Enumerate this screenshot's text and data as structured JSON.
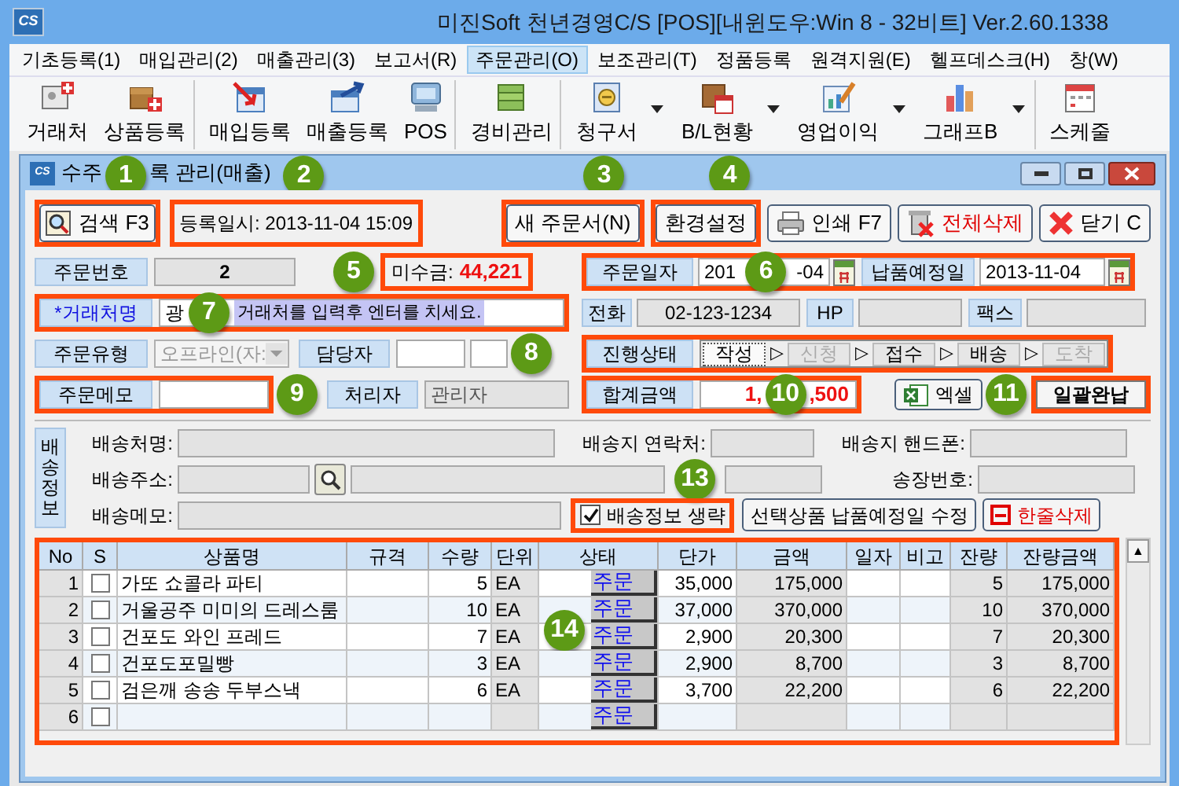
{
  "window": {
    "title": "미진Soft 천년경영C/S [POS][내윈도우:Win 8 - 32비트] Ver.2.60.1338",
    "logo": "CS"
  },
  "menu": [
    {
      "label": "기초등록(1)",
      "selected": false
    },
    {
      "label": "매입관리(2)",
      "selected": false
    },
    {
      "label": "매출관리(3)",
      "selected": false
    },
    {
      "label": "보고서(R)",
      "selected": false
    },
    {
      "label": "주문관리(O)",
      "selected": true
    },
    {
      "label": "보조관리(T)",
      "selected": false
    },
    {
      "label": "정품등록",
      "selected": false
    },
    {
      "label": "원격지원(E)",
      "selected": false
    },
    {
      "label": "헬프데스크(H)",
      "selected": false
    },
    {
      "label": "창(W)",
      "selected": false
    }
  ],
  "toolbar": [
    {
      "label": "거래처",
      "kind": "card",
      "dropdown": false,
      "separator_after": false
    },
    {
      "label": "상품등록",
      "kind": "box",
      "dropdown": false,
      "separator_after": true
    },
    {
      "label": "매입등록",
      "kind": "sheet-in",
      "dropdown": false,
      "separator_after": false
    },
    {
      "label": "매출등록",
      "kind": "sheet-out",
      "dropdown": false,
      "separator_after": false
    },
    {
      "label": "POS",
      "kind": "monitor",
      "dropdown": false,
      "separator_after": true
    },
    {
      "label": "경비관리",
      "kind": "money",
      "dropdown": false,
      "separator_after": true
    },
    {
      "label": "청구서",
      "kind": "invoice",
      "dropdown": true,
      "separator_after": false
    },
    {
      "label": "B/L현황",
      "kind": "crate",
      "dropdown": true,
      "separator_after": false
    },
    {
      "label": "영업이익",
      "kind": "pen",
      "dropdown": true,
      "separator_after": false
    },
    {
      "label": "그래프B",
      "kind": "chart",
      "dropdown": true,
      "separator_after": true
    },
    {
      "label": "스케줄",
      "kind": "calendar",
      "dropdown": false,
      "separator_after": false
    }
  ],
  "child_window": {
    "title_parts": [
      "수주",
      "록 관리(매출)"
    ],
    "logo": "CS"
  },
  "actions": [
    {
      "label": "검색 F3",
      "kind": "search"
    },
    {
      "label": "새 주문서(N)",
      "kind": "plain"
    },
    {
      "label": "환경설정",
      "kind": "plain"
    },
    {
      "label": "인쇄 F7",
      "kind": "print"
    },
    {
      "label": "전체삭제",
      "kind": "delete"
    },
    {
      "label": "닫기 C",
      "kind": "close"
    }
  ],
  "registered": "등록일시: 2013-11-04 15:09",
  "form": {
    "order_no_label": "주문번호",
    "order_no": "2",
    "receivable_label": "미수금:",
    "receivable": "44,221",
    "customer_label": "*거래처명",
    "customer_value": "광",
    "customer_hint": "거래처를 입력후 엔터를 치세요.",
    "order_type_label": "주문유형",
    "order_type": "오프라인(자:",
    "manager_label": "담당자",
    "memo_label": "주문메모",
    "handler_label": "처리자",
    "handler": "관리자",
    "order_date_label": "주문일자",
    "order_date_parts": [
      "201",
      "-04"
    ],
    "delivery_date_label": "납품예정일",
    "delivery_date": "2013-11-04",
    "phone_label": "전화",
    "phone": "02-123-1234",
    "hp_label": "HP",
    "fax_label": "팩스",
    "status_label": "진행상태",
    "steps": [
      {
        "label": "작성",
        "selected": true,
        "disabled": false
      },
      {
        "prefix": "▷",
        "label": "신청",
        "selected": false,
        "disabled": true
      },
      {
        "prefix": "▷",
        "label": "접수",
        "selected": false,
        "disabled": false
      },
      {
        "prefix": "▷",
        "label": "배송",
        "selected": false,
        "disabled": false
      },
      {
        "prefix": "▷",
        "label": "도착",
        "selected": false,
        "disabled": true
      }
    ],
    "total_label": "합계금액",
    "total_parts": [
      "1,",
      ",500"
    ],
    "excel": "엑셀",
    "settle": "일괄완납"
  },
  "shipping": {
    "tab": "배송정보",
    "name_label": "배송처명:",
    "contact_label": "배송지 연락처:",
    "mobile_label": "배송지 핸드폰:",
    "address_label": "배송주소:",
    "invoice_label": "송장번호:",
    "memo_label": "배송메모:",
    "skip_label": "배송정보 생략",
    "skip_checked": true,
    "edit_date": "선택상품 납품예정일 수정",
    "delete_row": "한줄삭제"
  },
  "table": {
    "columns": [
      "No",
      "S",
      "상품명",
      "규격",
      "수량",
      "단위",
      "상태",
      "단가",
      "금액",
      "일자",
      "비고",
      "잔량",
      "잔량금액"
    ],
    "rows": [
      {
        "no": "1",
        "checked": false,
        "name": "가또 쇼콜라 파티",
        "qty": "5",
        "unit": "EA",
        "status": "주문",
        "price": "35,000",
        "amount": "175,000",
        "remain": "5",
        "remain_amount": "175,000"
      },
      {
        "no": "2",
        "checked": false,
        "name": "거울공주 미미의 드레스룸",
        "qty": "10",
        "unit": "EA",
        "status": "주문",
        "price": "37,000",
        "amount": "370,000",
        "remain": "10",
        "remain_amount": "370,000"
      },
      {
        "no": "3",
        "checked": false,
        "name": "건포도 와인 프레드",
        "qty": "7",
        "unit": "EA",
        "status": "주문",
        "price": "2,900",
        "amount": "20,300",
        "remain": "7",
        "remain_amount": "20,300"
      },
      {
        "no": "4",
        "checked": false,
        "name": "건포도포밀빵",
        "qty": "3",
        "unit": "EA",
        "status": "주문",
        "price": "2,900",
        "amount": "8,700",
        "remain": "3",
        "remain_amount": "8,700"
      },
      {
        "no": "5",
        "checked": false,
        "name": "검은깨 송송 두부스낵",
        "qty": "6",
        "unit": "EA",
        "status": "주문",
        "price": "3,700",
        "amount": "22,200",
        "remain": "6",
        "remain_amount": "22,200"
      },
      {
        "no": "6",
        "checked": false,
        "status": "주문"
      }
    ],
    "scroll_up": "▲"
  },
  "callouts": [
    "1",
    "2",
    "3",
    "4",
    "5",
    "6",
    "7",
    "8",
    "9",
    "10",
    "11",
    "13",
    "14"
  ]
}
